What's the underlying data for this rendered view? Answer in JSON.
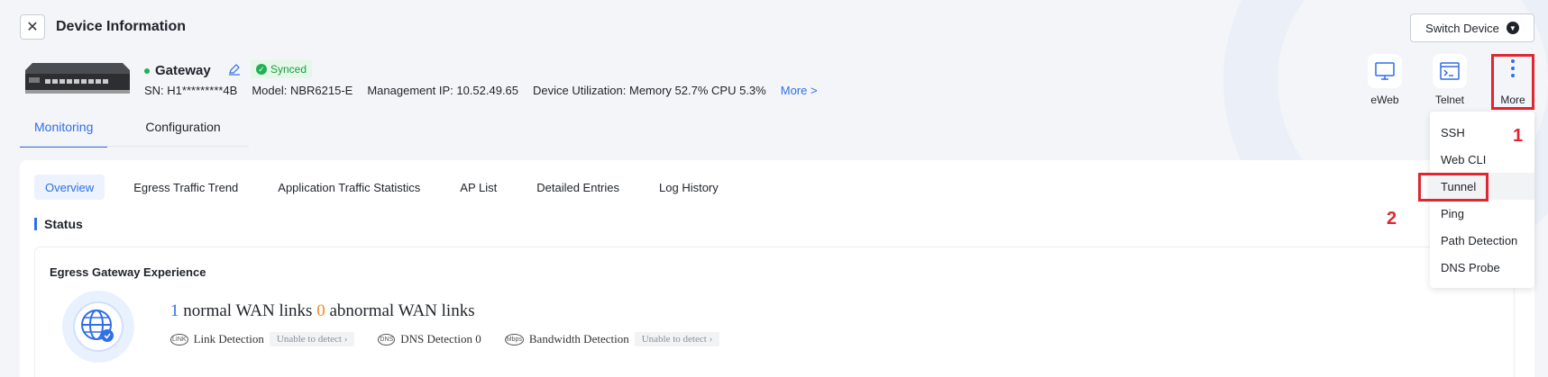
{
  "header": {
    "title": "Device Information",
    "switch_device": "Switch Device"
  },
  "device": {
    "name": "Gateway",
    "sync_status": "Synced",
    "sn": "SN: H1*********4B",
    "model": "Model: NBR6215-E",
    "ip": "Management IP: 10.52.49.65",
    "utilization_label": "Device Utilization:",
    "memory": "Memory 52.7%",
    "cpu": "CPU 5.3%",
    "more": "More >"
  },
  "tools": {
    "eweb": "eWeb",
    "telnet": "Telnet",
    "more": "More"
  },
  "main_tabs": [
    "Monitoring",
    "Configuration"
  ],
  "sub_tabs": [
    "Overview",
    "Egress Traffic Trend",
    "Application Traffic Statistics",
    "AP List",
    "Detailed Entries",
    "Log History"
  ],
  "status": {
    "title": "Status",
    "card_title": "Egress Gateway Experience",
    "normal_count": "1",
    "normal_text": " normal WAN links ",
    "abnormal_count": "0",
    "abnormal_text": " abnormal WAN links",
    "link_detection": "Link Detection",
    "link_status": "Unable to detect",
    "dns_detection": "DNS Detection 0",
    "bandwidth_detection": "Bandwidth Detection",
    "bandwidth_status": "Unable to detect",
    "icon_labels": {
      "link": "LINK",
      "dns": "DNS",
      "mbps": "Mbps"
    }
  },
  "dropdown": [
    "SSH",
    "Web CLI",
    "Tunnel",
    "Ping",
    "Path Detection",
    "DNS Probe"
  ],
  "annotations": {
    "one": "1",
    "two": "2"
  },
  "colors": {
    "accent": "#2f6fe8",
    "highlight": "#e02631",
    "success": "#1fb155"
  }
}
